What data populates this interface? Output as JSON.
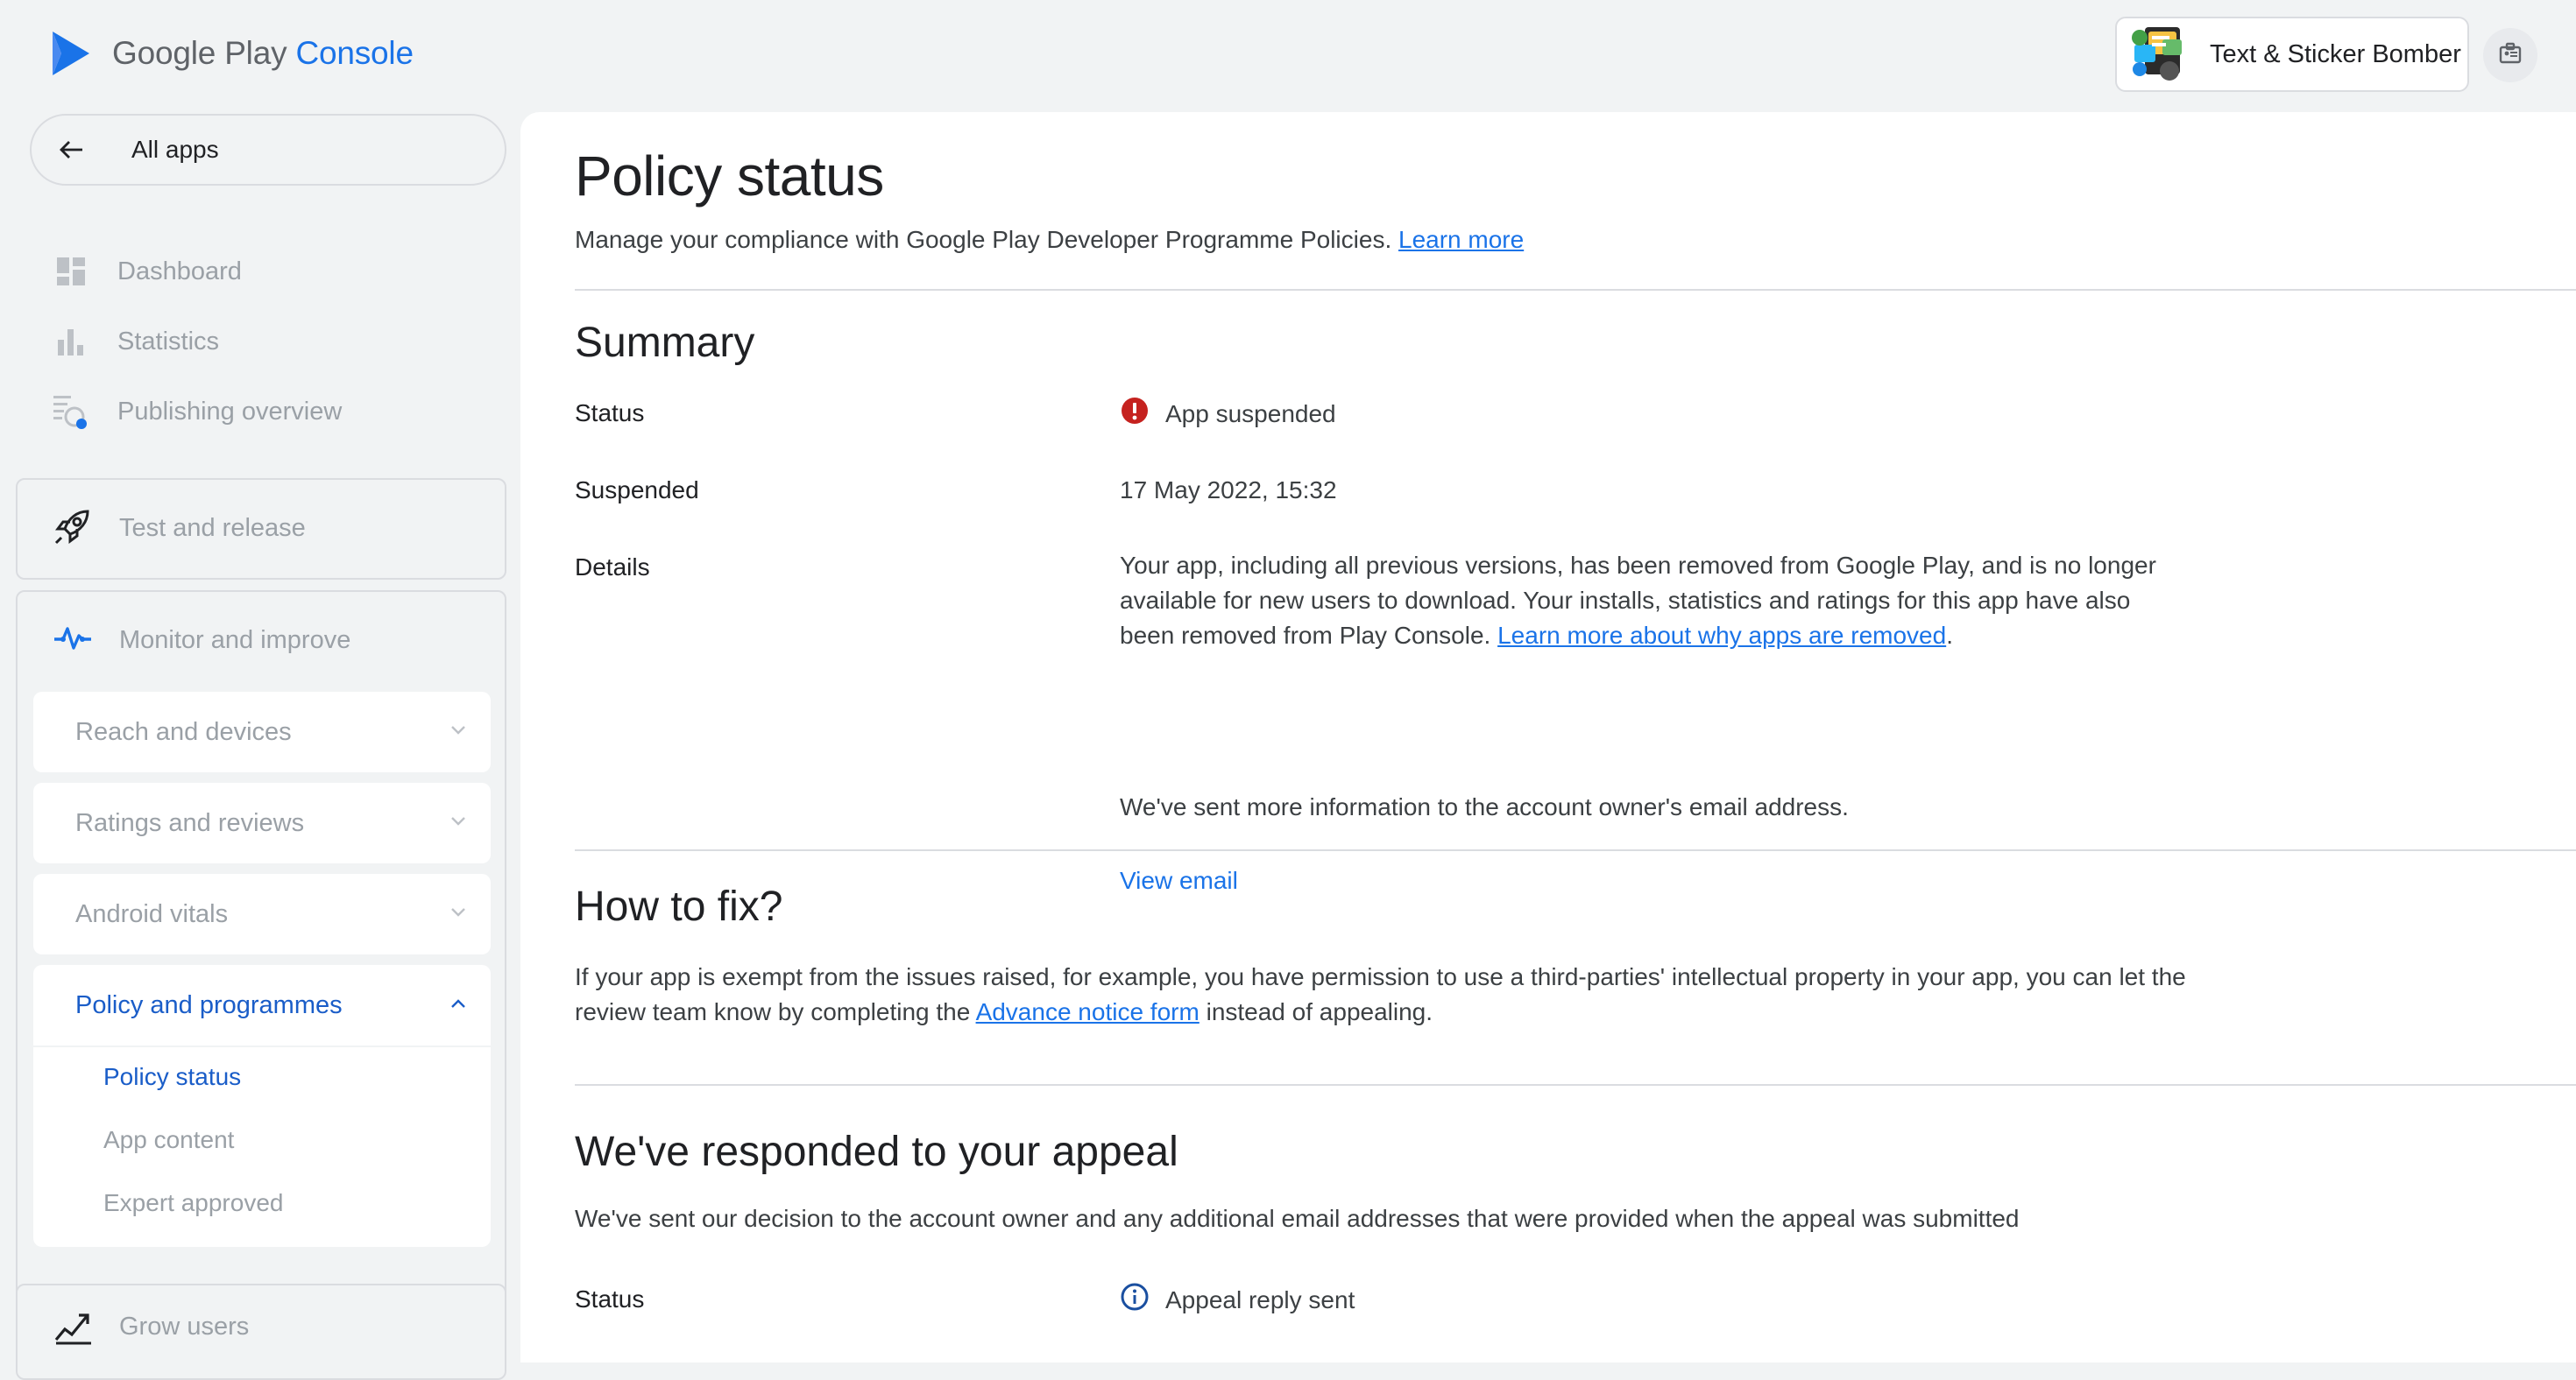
{
  "header": {
    "logo_google": "Google Play",
    "logo_console": "Console",
    "app_name": "Text & Sticker Bomber"
  },
  "sidebar": {
    "all_apps": "All apps",
    "items": [
      {
        "label": "Dashboard",
        "icon": "dashboard-icon"
      },
      {
        "label": "Statistics",
        "icon": "bar-chart-icon"
      },
      {
        "label": "Publishing overview",
        "icon": "publishing-icon"
      }
    ],
    "test_release": "Test and release",
    "monitor": {
      "label": "Monitor and improve",
      "sub": [
        {
          "label": "Reach and devices"
        },
        {
          "label": "Ratings and reviews"
        },
        {
          "label": "Android vitals"
        }
      ],
      "policy": {
        "label": "Policy and programmes",
        "links": [
          "Policy status",
          "App content",
          "Expert approved"
        ]
      }
    },
    "grow_users": "Grow users"
  },
  "page": {
    "title": "Policy status",
    "subtitle": "Manage your compliance with Google Play Developer Programme Policies.",
    "subtitle_link": "Learn more",
    "summary": {
      "heading": "Summary",
      "status_label": "Status",
      "status_value": "App suspended",
      "suspended_label": "Suspended",
      "suspended_value": "17 May 2022, 15:32",
      "details_label": "Details",
      "details_text": "Your app, including all previous versions, has been removed from Google Play, and is no longer available for new users to download. Your installs, statistics and ratings for this app have also been removed from Play Console.",
      "details_link": "Learn more about why apps are removed",
      "details_text2": "We've sent more information to the account owner's email address.",
      "view_email": "View email"
    },
    "fix": {
      "heading": "How to fix?",
      "text_before": "If your app is exempt from the issues raised, for example, you have permission to use a third-parties' intellectual property in your app, you can let the review team know by completing the",
      "link": "Advance notice form",
      "text_after": "instead of appealing."
    },
    "appeal": {
      "heading": "We've responded to your appeal",
      "text": "We've sent our decision to the account owner and any additional email addresses that were provided when the appeal was submitted",
      "status_label": "Status",
      "status_value": "Appeal reply sent"
    }
  },
  "colors": {
    "accent": "#1a73e8",
    "error": "#d93025",
    "muted": "#9aa0a6"
  }
}
